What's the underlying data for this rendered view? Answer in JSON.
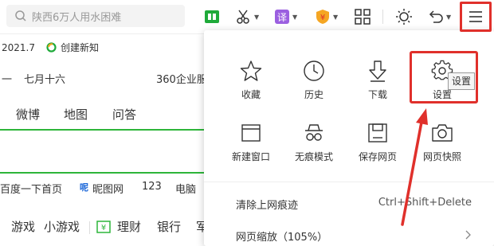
{
  "toolbar": {
    "search_placeholder": "陕西6万人用水困难"
  },
  "bookmarks": {
    "date_text": "2021.7",
    "item": "创建新知"
  },
  "calendar": {
    "weekday": "一",
    "lunar": "七月十六",
    "ad": "360企业服"
  },
  "tabs": [
    "微博",
    "地图",
    "问答"
  ],
  "links": [
    "百度一下首页",
    "昵图网",
    "123",
    "电脑"
  ],
  "categories": [
    "游戏",
    "小游戏",
    "理财",
    "银行",
    "军"
  ],
  "menu": {
    "grid": [
      {
        "label": "收藏",
        "icon": "star-icon"
      },
      {
        "label": "历史",
        "icon": "clock-icon"
      },
      {
        "label": "下载",
        "icon": "download-icon"
      },
      {
        "label": "设置",
        "icon": "gear-icon"
      },
      {
        "label": "新建窗口",
        "icon": "window-icon"
      },
      {
        "label": "无痕模式",
        "icon": "incognito-icon"
      },
      {
        "label": "保存网页",
        "icon": "save-icon"
      },
      {
        "label": "网页快照",
        "icon": "camera-icon"
      }
    ],
    "clear_trace": "清除上网痕迹",
    "clear_shortcut": "Ctrl+Shift+Delete",
    "zoom": "网页缩放（105%）",
    "tooltip": "设置"
  },
  "colors": {
    "accent_red": "#e0302b",
    "green": "#2db53a"
  }
}
